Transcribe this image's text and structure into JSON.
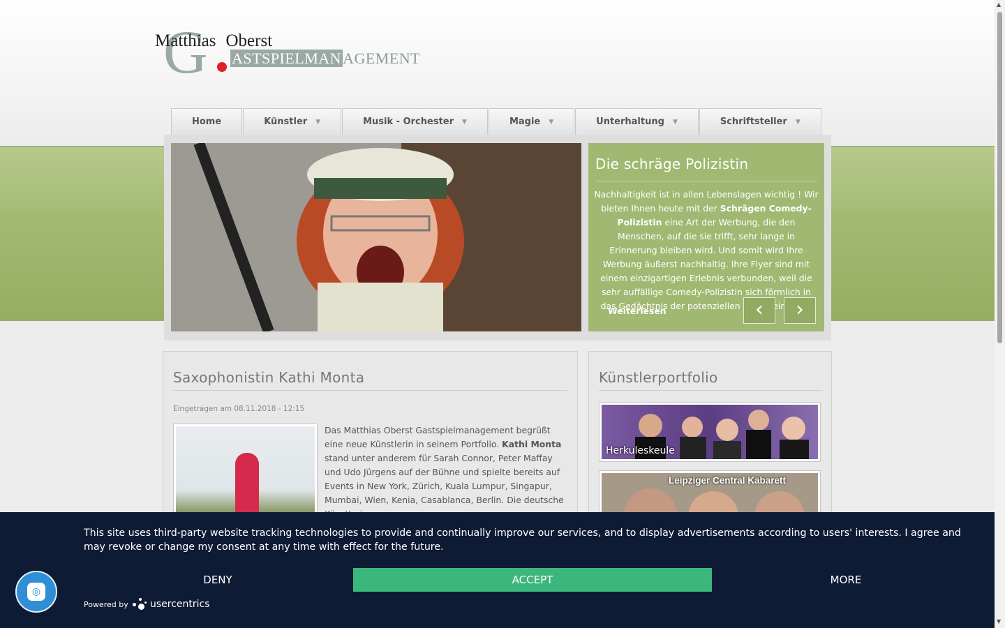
{
  "logo": {
    "first": "Matthias",
    "last": "Oberst",
    "letter": "G",
    "sub_highlight": "ASTSPIELMAN",
    "sub_rest": "AGEMENT"
  },
  "nav": {
    "items": [
      {
        "label": "Home"
      },
      {
        "label": "Künstler"
      },
      {
        "label": "Musik - Orchester"
      },
      {
        "label": "Magie"
      },
      {
        "label": "Unterhaltung"
      },
      {
        "label": "Schriftsteller"
      }
    ]
  },
  "slider": {
    "title": "Die schräge Polizistin",
    "text_1": "Nachhaltigkeit ist in allen Lebenslagen wichtig ! Wir bieten Ihnen heute mit der ",
    "text_bold": "Schrägen Comedy-Polizistin",
    "text_2": " eine Art der Werbung, die den Menschen, auf die sie trifft, sehr lange in Erinnerung bleiben wird. Und somit wird Ihre Werbung äußerst nachhaltig. Ihre Flyer sind mit einem einzigartigen Erlebnis verbunden, weil die sehr auffällige Comedy-Polizistin sich förmlich in das Gedächtnis der potenziellen Kunde eingräbt.",
    "more": "Weiterlesen",
    "prev": "‹",
    "next": "›"
  },
  "article": {
    "title": "Saxophonistin Kathi Monta",
    "date": "Eingetragen am 08.11.2018 - 12:15",
    "text_1": "Das Matthias Oberst Gastspielmanagement begrüßt eine neue Künstlerin in seinem Portfolio. ",
    "text_bold": "Kathi Monta",
    "text_2": " stand unter anderem für Sarah Connor, Peter Maffay und Udo Jürgens auf der Bühne und spielte bereits auf Events in New York, Zürich, Kuala Lumpur, Singapur, Mumbai, Wien, Kenia, Casablanca, Berlin. Die deutsche Künstlerin ..."
  },
  "portfolio": {
    "title": "Künstlerportfolio",
    "cards": [
      {
        "caption": "Herkuleskeule"
      },
      {
        "caption": "Leipziger Central Kabarett"
      }
    ]
  },
  "cookie": {
    "message": "This site uses third-party website tracking technologies to provide and continually improve our services, and to display advertisements according to users' interests. I agree and may revoke or change my consent at any time with effect for the future.",
    "deny": "DENY",
    "accept": "ACCEPT",
    "more": "MORE",
    "powered": "Powered by",
    "brand": "usercentrics"
  },
  "colors": {
    "accent_green": "#a1b872",
    "accept_green": "#3cb77c",
    "banner_navy": "#0d1b34",
    "fab_blue": "#2f8fd5"
  },
  "icons": {
    "caret": "caret-down-icon",
    "fab": "fingerprint-icon"
  }
}
